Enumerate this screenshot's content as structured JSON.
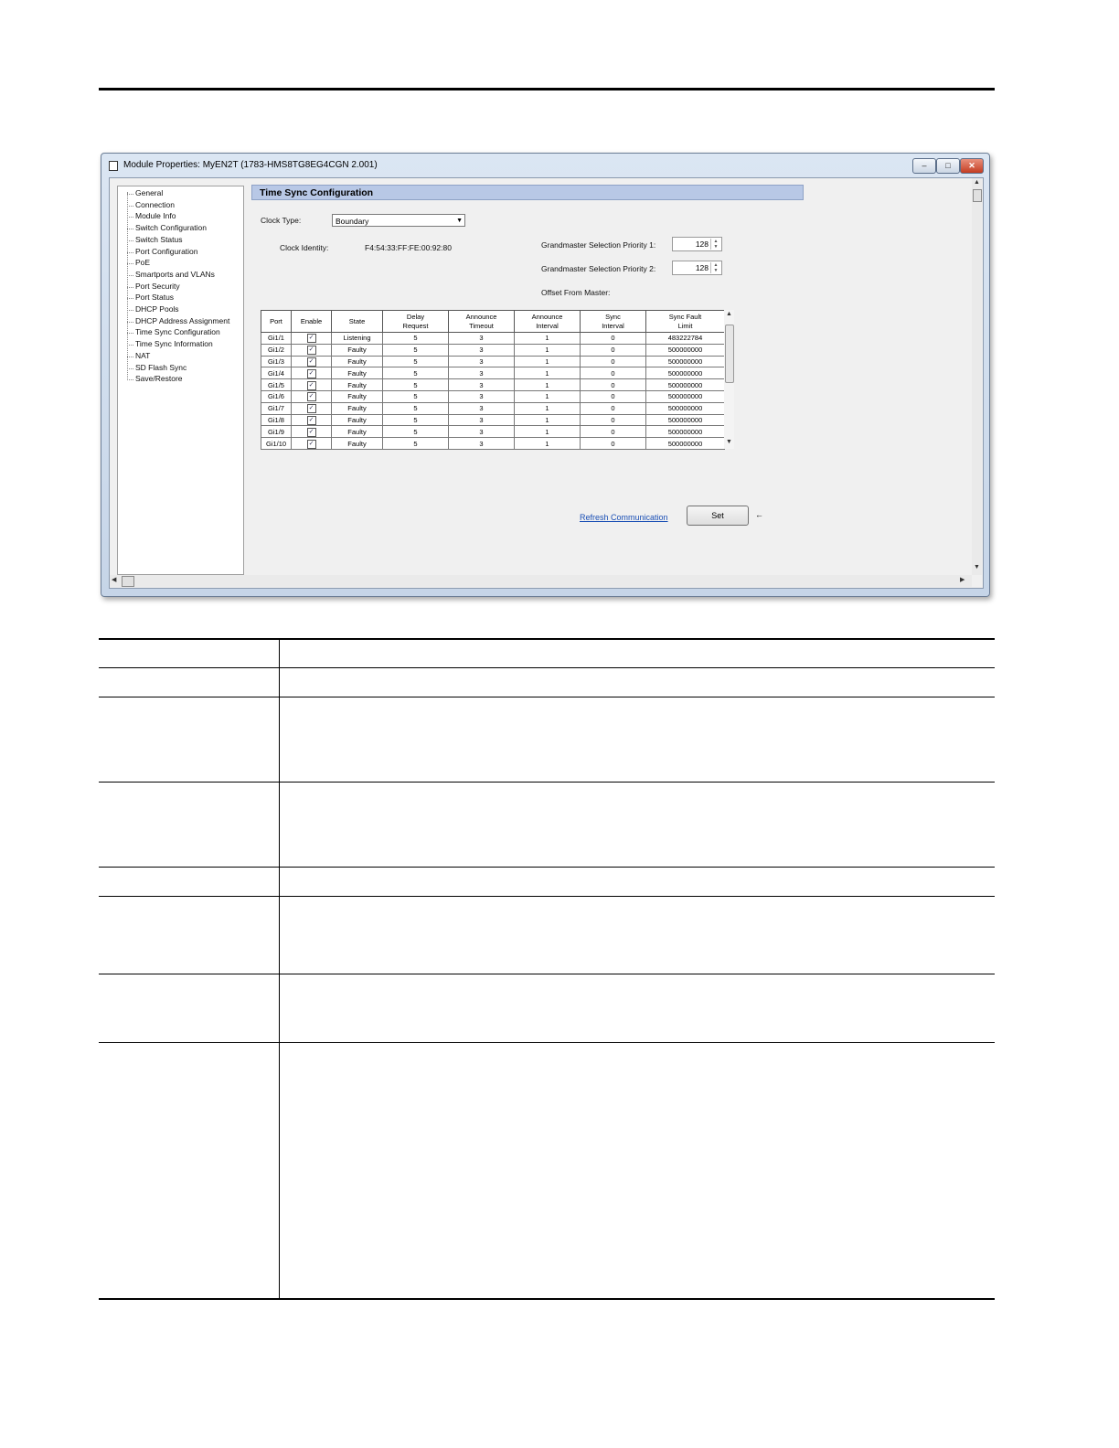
{
  "window": {
    "title": "Module Properties: MyEN2T (1783-HMS8TG8EG4CGN 2.001)",
    "min_label": "–",
    "max_label": "□",
    "close_label": "✕"
  },
  "tree": {
    "items": [
      "General",
      "Connection",
      "Module Info",
      "Switch Configuration",
      "Switch Status",
      "Port Configuration",
      "PoE",
      "Smartports and VLANs",
      "Port Security",
      "Port Status",
      "DHCP Pools",
      "DHCP Address Assignment",
      "Time Sync Configuration",
      "Time Sync Information",
      "NAT",
      "SD Flash Sync",
      "Save/Restore"
    ]
  },
  "panel": {
    "title": "Time Sync Configuration",
    "clock_type_label": "Clock Type:",
    "clock_type_value": "Boundary",
    "clock_identity_label": "Clock Identity:",
    "clock_identity_value": "F4:54:33:FF:FE:00:92:80",
    "gm_priority1_label": "Grandmaster Selection Priority 1:",
    "gm_priority1_value": "128",
    "gm_priority2_label": "Grandmaster Selection Priority 2:",
    "gm_priority2_value": "128",
    "offset_label": "Offset From Master:",
    "refresh_link": "Refresh Communication",
    "set_button": "Set",
    "set_arrow": "←"
  },
  "port_table": {
    "headers": [
      [
        "Port"
      ],
      [
        "Enable"
      ],
      [
        "State"
      ],
      [
        "Delay",
        "Request"
      ],
      [
        "Announce",
        "Timeout"
      ],
      [
        "Announce",
        "Interval"
      ],
      [
        "Sync",
        "Interval"
      ],
      [
        "Sync Fault",
        "Limit"
      ]
    ],
    "rows": [
      [
        "Gi1/1",
        "✓",
        "Listening",
        "5",
        "3",
        "1",
        "0",
        "483222784"
      ],
      [
        "Gi1/2",
        "✓",
        "Faulty",
        "5",
        "3",
        "1",
        "0",
        "500000000"
      ],
      [
        "Gi1/3",
        "✓",
        "Faulty",
        "5",
        "3",
        "1",
        "0",
        "500000000"
      ],
      [
        "Gi1/4",
        "✓",
        "Faulty",
        "5",
        "3",
        "1",
        "0",
        "500000000"
      ],
      [
        "Gi1/5",
        "✓",
        "Faulty",
        "5",
        "3",
        "1",
        "0",
        "500000000"
      ],
      [
        "Gi1/6",
        "✓",
        "Faulty",
        "5",
        "3",
        "1",
        "0",
        "500000000"
      ],
      [
        "Gi1/7",
        "✓",
        "Faulty",
        "5",
        "3",
        "1",
        "0",
        "500000000"
      ],
      [
        "Gi1/8",
        "✓",
        "Faulty",
        "5",
        "3",
        "1",
        "0",
        "500000000"
      ],
      [
        "Gi1/9",
        "✓",
        "Faulty",
        "5",
        "3",
        "1",
        "0",
        "500000000"
      ],
      [
        "Gi1/10",
        "✓",
        "Faulty",
        "5",
        "3",
        "1",
        "0",
        "500000000"
      ]
    ]
  }
}
